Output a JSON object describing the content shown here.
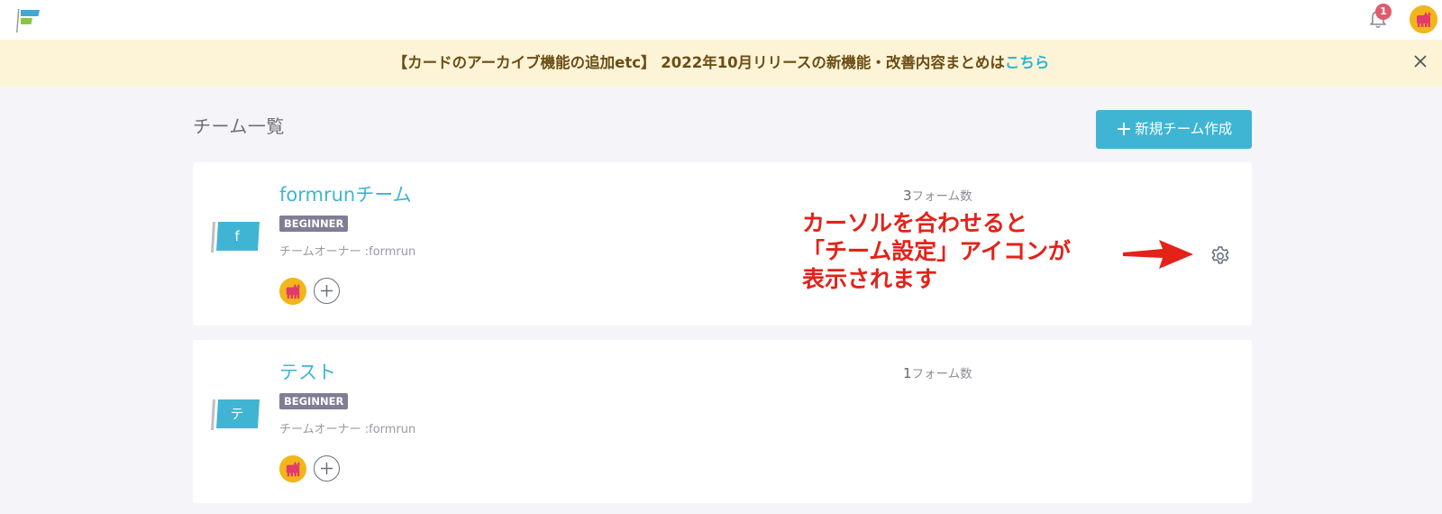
{
  "topbar": {
    "notification_count": "1"
  },
  "banner": {
    "text": "【カードのアーカイブ機能の追加etc】 2022年10月リリースの新機能・改善内容まとめは",
    "link_text": "こちら"
  },
  "page": {
    "title": "チーム一覧",
    "new_team_plus": "+",
    "new_team_label": "新規チーム作成"
  },
  "teams": [
    {
      "initial": "f",
      "name": "formrunチーム",
      "plan": "BEGINNER",
      "owner": "チームオーナー :formrun",
      "form_count": "3",
      "form_count_label": "フォーム数"
    },
    {
      "initial": "テ",
      "name": "テスト",
      "plan": "BEGINNER",
      "owner": "チームオーナー :formrun",
      "form_count": "1",
      "form_count_label": "フォーム数"
    }
  ],
  "annotation": {
    "line1": "カーソルを合わせると",
    "line2": "「チーム設定」アイコンが",
    "line3": "表示されます"
  },
  "colors": {
    "accent": "#3fb5d3",
    "banner_bg": "#fdf3d7",
    "annotation": "#e32219",
    "badge": "#7f7e94"
  },
  "icons": [
    "formrun-logo-icon",
    "bell-icon",
    "close-icon",
    "plus-icon",
    "gear-icon",
    "arrow-icon",
    "flag-icon"
  ]
}
